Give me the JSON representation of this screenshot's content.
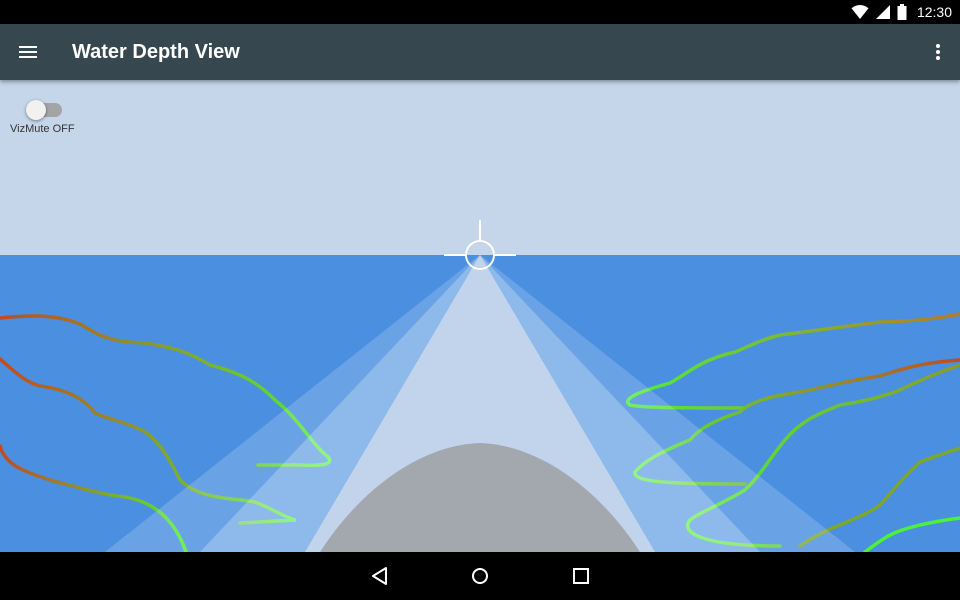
{
  "status_bar": {
    "time": "12:30",
    "icons": [
      "wifi-icon",
      "cell-signal-icon",
      "battery-icon"
    ]
  },
  "app_bar": {
    "title": "Water Depth View",
    "menu_icon": "menu-icon",
    "overflow_icon": "more-vert-icon"
  },
  "viz_mute": {
    "label": "VizMute OFF",
    "enabled": false
  },
  "nav_bar": {
    "icons": [
      "back-icon",
      "home-icon",
      "recents-icon"
    ]
  },
  "colors": {
    "sky": "#c6d6ea",
    "water": "#4a8fe0",
    "app_bar": "#37474f",
    "boat": "#a3a8af",
    "contour_shallow": "#4df03a",
    "contour_deep": "#c44a20"
  }
}
